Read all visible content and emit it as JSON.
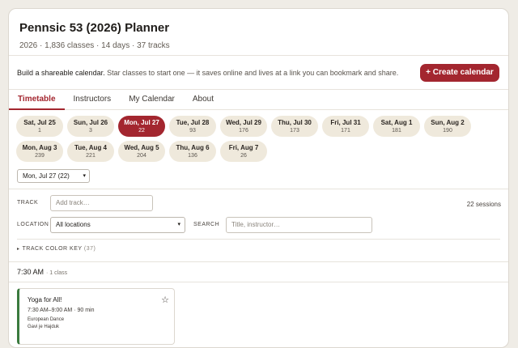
{
  "header": {
    "title": "Pennsic 53 (2026) Planner",
    "subtitle": "2026 · 1,836 classes · 14 days · 37 tracks"
  },
  "promo": {
    "lead": "Build a shareable calendar.",
    "text": " Star classes to start one — it saves online and lives at a link you can bookmark and share.",
    "button": "+ Create calendar"
  },
  "tabs": [
    {
      "label": "Timetable"
    },
    {
      "label": "Instructors"
    },
    {
      "label": "My Calendar"
    },
    {
      "label": "About"
    }
  ],
  "days": [
    {
      "label": "Sat, Jul 25",
      "count": "1"
    },
    {
      "label": "Sun, Jul 26",
      "count": "3"
    },
    {
      "label": "Mon, Jul 27",
      "count": "22"
    },
    {
      "label": "Tue, Jul 28",
      "count": "93"
    },
    {
      "label": "Wed, Jul 29",
      "count": "176"
    },
    {
      "label": "Thu, Jul 30",
      "count": "173"
    },
    {
      "label": "Fri, Jul 31",
      "count": "171"
    },
    {
      "label": "Sat, Aug 1",
      "count": "181"
    },
    {
      "label": "Sun, Aug 2",
      "count": "190"
    },
    {
      "label": "Mon, Aug 3",
      "count": "239"
    },
    {
      "label": "Tue, Aug 4",
      "count": "221"
    },
    {
      "label": "Wed, Aug 5",
      "count": "204"
    },
    {
      "label": "Thu, Aug 6",
      "count": "136"
    },
    {
      "label": "Fri, Aug 7",
      "count": "26"
    }
  ],
  "selected_day": "Mon, Jul 27 (22)",
  "filters": {
    "track_label": "TRACK",
    "track_placeholder": "Add track…",
    "sessions": "22 sessions",
    "location_label": "LOCATION",
    "location_value": "All locations",
    "search_label": "SEARCH",
    "search_placeholder": "Title, instructor…",
    "key_label": "TRACK COLOR KEY",
    "key_count": "(37)"
  },
  "slot": {
    "time": "7:30 AM",
    "classes": "· 1 class"
  },
  "session": {
    "title": "Yoga for All!",
    "time": "7:30 AM–9:00 AM · 90 min",
    "track": "European Dance",
    "instructor": "Gavi je Hajduk",
    "track_color": "#3a7a3e"
  },
  "colors": {
    "accent": "#a3262f"
  },
  "icons": {
    "star": "star-outline-icon",
    "chevron": "chevron-down-icon",
    "triangle": "triangle-right-icon"
  }
}
